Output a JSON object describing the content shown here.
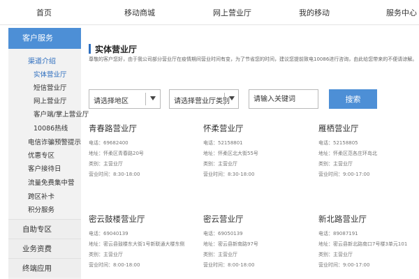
{
  "nav": {
    "items": [
      "首页",
      "移动商城",
      "网上营业厅",
      "我的移动",
      "服务中心"
    ]
  },
  "sidebar": {
    "header": "客户服务",
    "group_title": "渠道介绍",
    "group_items": [
      "实体营业厅",
      "短信营业厅",
      "网上营业厅",
      "客户端/掌上营业厅",
      "10086热线"
    ],
    "items": [
      "电信诈骗预警提示",
      "优惠专区",
      "客户接待日",
      "流量免费集中营",
      "跨区补卡",
      "积分服务"
    ],
    "sections": [
      "自助专区",
      "业务资费",
      "终端应用"
    ]
  },
  "main": {
    "title": "实体营业厅",
    "notice": "尊敬的客户您好，由于我公司部分营业厅在疫情期间营业时间有变，为了节省您的时间，建议您提前致电10086进行咨询，由此给您带来的不便请谅解。"
  },
  "filters": {
    "region": "请选择地区",
    "hall_type": "请选择营业厅类别",
    "keyword_placeholder": "请输入关键词",
    "search_label": "搜索"
  },
  "halls": [
    {
      "name": "青春路营业厅",
      "phone": "电话：69682400",
      "address": "地址：怀柔区青春路20号",
      "category": "类别：主营业厅",
      "hours": "营业时间：8:30-18:00"
    },
    {
      "name": "怀柔营业厅",
      "phone": "电话：52158801",
      "address": "地址：怀柔区北大街55号",
      "category": "类别：主营业厅",
      "hours": "营业时间：8:30-18:00"
    },
    {
      "name": "雁栖营业厅",
      "phone": "电话：52158805",
      "address": "地址：怀柔区范各庄环岛北",
      "category": "类别：主营业厅",
      "hours": "营业时间：9:00-17:00"
    },
    {
      "name": "密云鼓楼营业厅",
      "phone": "电话：69040139",
      "address": "地址：密云县鼓楼东大街1号新联通大楼东侧",
      "category": "类别：主营业厅",
      "hours": "营业时间：8:00-18:00"
    },
    {
      "name": "密云营业厅",
      "phone": "电话：69050139",
      "address": "地址：密云县新南路97号",
      "category": "类别：主营业厅",
      "hours": "营业时间：8:00-18:00"
    },
    {
      "name": "新北路营业厅",
      "phone": "电话：89087191",
      "address": "地址：密云县新北路南口7号楼3单元101",
      "category": "类别：主营业厅",
      "hours": "营业时间：9:00-17:00"
    }
  ],
  "colors": {
    "accent": "#4d8fd6",
    "link": "#2f6fbf"
  }
}
